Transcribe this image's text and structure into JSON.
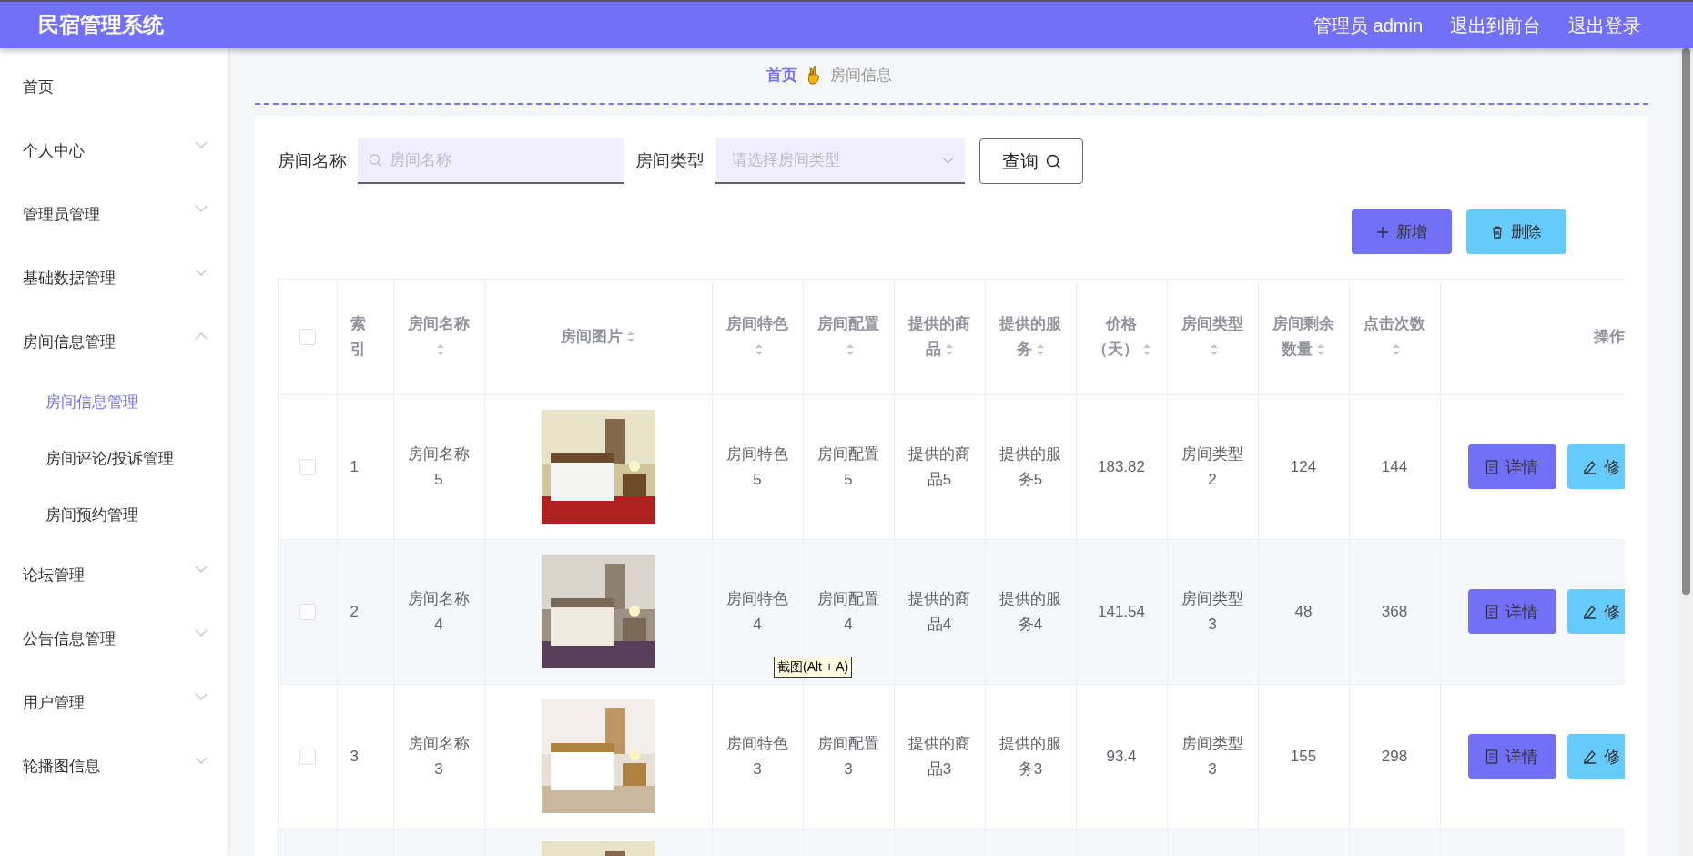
{
  "header": {
    "title": "民宿管理系统",
    "links": [
      "管理员 admin",
      "退出到前台",
      "退出登录"
    ]
  },
  "sidebar": {
    "items": [
      {
        "label": "首页",
        "kind": "link",
        "selected": false
      },
      {
        "label": "个人中心",
        "kind": "menu",
        "expanded": false
      },
      {
        "label": "管理员管理",
        "kind": "menu",
        "expanded": false
      },
      {
        "label": "基础数据管理",
        "kind": "menu",
        "expanded": false
      },
      {
        "label": "房间信息管理",
        "kind": "menu",
        "expanded": true,
        "children": [
          {
            "label": "房间信息管理",
            "selected": true
          },
          {
            "label": "房间评论/投诉管理",
            "selected": false
          },
          {
            "label": "房间预约管理",
            "selected": false
          }
        ]
      },
      {
        "label": "论坛管理",
        "kind": "menu",
        "expanded": false
      },
      {
        "label": "公告信息管理",
        "kind": "menu",
        "expanded": false
      },
      {
        "label": "用户管理",
        "kind": "menu",
        "expanded": false
      },
      {
        "label": "轮播图信息",
        "kind": "menu",
        "expanded": false
      }
    ]
  },
  "breadcrumb": {
    "home": "首页",
    "current": "房间信息"
  },
  "search": {
    "fields": [
      {
        "label": "房间名称",
        "placeholder": "房间名称",
        "kind": "text"
      },
      {
        "label": "房间类型",
        "placeholder": "请选择房间类型",
        "kind": "select"
      }
    ],
    "button": "查询"
  },
  "actions": [
    {
      "label": "新增",
      "kind": "add"
    },
    {
      "label": "删除",
      "kind": "delete"
    }
  ],
  "table": {
    "select_all": {
      "checked": false
    },
    "columns": [
      {
        "label": "索引",
        "sortable": false
      },
      {
        "label": "房间名称",
        "sortable": true
      },
      {
        "label": "房间图片",
        "sortable": true
      },
      {
        "label": "房间特色",
        "sortable": true
      },
      {
        "label": "房间配置",
        "sortable": true
      },
      {
        "label": "提供的商品",
        "sortable": true
      },
      {
        "label": "提供的服务",
        "sortable": true
      },
      {
        "label": "价格（天）",
        "sortable": true
      },
      {
        "label": "房间类型",
        "sortable": true
      },
      {
        "label": "房间剩余数量",
        "sortable": true
      },
      {
        "label": "点击次数",
        "sortable": true
      },
      {
        "label": "操作",
        "sortable": false
      }
    ],
    "rows": [
      {
        "checked": false,
        "cells": [
          "1",
          "房间名称5",
          {
            "kind": "picture"
          },
          "房间特色5",
          "房间配置5",
          "提供的商品5",
          "提供的服务5",
          "183.82",
          "房间类型2",
          "124",
          "144"
        ],
        "actions": [
          {
            "label": "详情",
            "kind": "detail"
          },
          {
            "label": "修",
            "kind": "edit"
          }
        ]
      },
      {
        "checked": false,
        "cells": [
          "2",
          "房间名称4",
          {
            "kind": "picture"
          },
          "房间特色4",
          "房间配置4",
          "提供的商品4",
          "提供的服务4",
          "141.54",
          "房间类型3",
          "48",
          "368"
        ],
        "actions": [
          {
            "label": "详情",
            "kind": "detail"
          },
          {
            "label": "修",
            "kind": "edit"
          }
        ]
      },
      {
        "checked": false,
        "cells": [
          "3",
          "房间名称3",
          {
            "kind": "picture"
          },
          "房间特色3",
          "房间配置3",
          "提供的商品3",
          "提供的服务3",
          "93.4",
          "房间类型3",
          "155",
          "298"
        ],
        "actions": [
          {
            "label": "详情",
            "kind": "detail"
          },
          {
            "label": "修",
            "kind": "edit"
          }
        ]
      },
      {
        "cells": [
          "",
          "",
          {
            "kind": "picture"
          },
          "",
          "",
          "",
          "",
          "",
          "",
          "",
          ""
        ]
      }
    ]
  },
  "tooltip": "截图(Alt + A)"
}
